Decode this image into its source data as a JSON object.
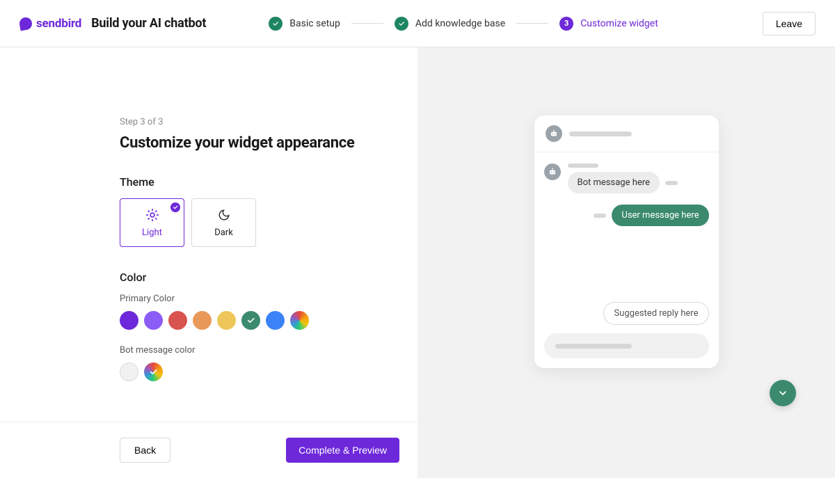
{
  "brand": {
    "name": "sendbird"
  },
  "app_title": "Build your AI chatbot",
  "header": {
    "steps": [
      {
        "label": "Basic setup",
        "status": "done"
      },
      {
        "label": "Add knowledge base",
        "status": "done"
      },
      {
        "number": "3",
        "label": "Customize widget",
        "status": "current"
      }
    ],
    "leave_label": "Leave"
  },
  "page": {
    "step_counter": "Step 3 of 3",
    "title": "Customize your widget appearance"
  },
  "theme": {
    "section_label": "Theme",
    "options": [
      {
        "value": "light",
        "label": "Light",
        "selected": true
      },
      {
        "value": "dark",
        "label": "Dark",
        "selected": false
      }
    ]
  },
  "color": {
    "section_label": "Color",
    "primary": {
      "label": "Primary Color",
      "swatches": [
        {
          "hex": "#6d28d9",
          "selected": false
        },
        {
          "hex": "#8b5cf6",
          "selected": false
        },
        {
          "hex": "#d9534f",
          "selected": false
        },
        {
          "hex": "#e8995a",
          "selected": false
        },
        {
          "hex": "#eec75a",
          "selected": false
        },
        {
          "hex": "#3b8a6e",
          "selected": true
        },
        {
          "hex": "#3b82f6",
          "selected": false
        },
        {
          "type": "rainbow",
          "selected": false
        }
      ]
    },
    "bot_message": {
      "label": "Bot message color",
      "swatches": [
        {
          "hex": "#f1f1f1",
          "border": true,
          "selected": false
        },
        {
          "type": "rainbow",
          "selected": true
        }
      ]
    }
  },
  "footer": {
    "back_label": "Back",
    "submit_label": "Complete & Preview"
  },
  "preview": {
    "bot_message": "Bot message here",
    "user_message": "User message here",
    "suggested_reply": "Suggested reply here",
    "primary_color": "#3b8a6e",
    "bot_bubble_color": "#ececec"
  }
}
